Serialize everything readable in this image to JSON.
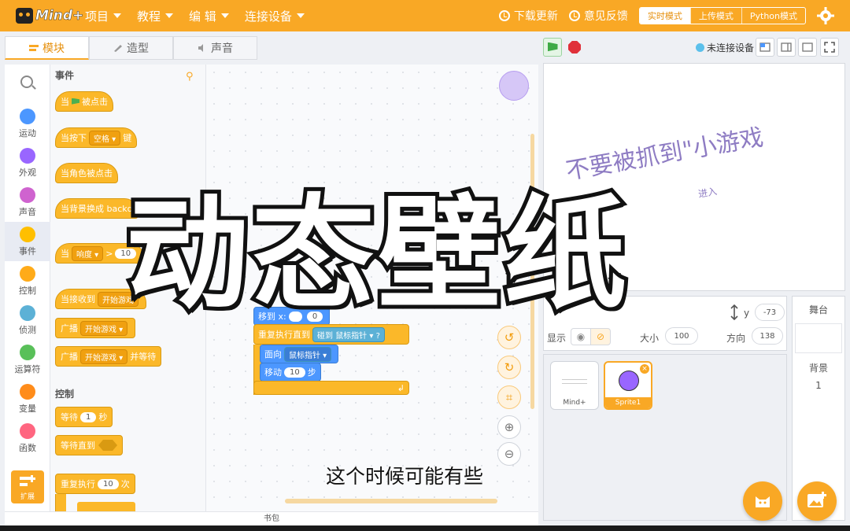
{
  "app": {
    "brand": "Mind+"
  },
  "menu": [
    {
      "label": "项目"
    },
    {
      "label": "教程"
    },
    {
      "label": "编 辑"
    },
    {
      "label": "连接设备"
    }
  ],
  "top_right": {
    "download": "下载更新",
    "feedback": "意见反馈",
    "modes": [
      "实时模式",
      "上传模式",
      "Python模式"
    ]
  },
  "tabs": [
    "模块",
    "造型",
    "声音"
  ],
  "categories": [
    {
      "label": "运动",
      "color": "#4c97ff"
    },
    {
      "label": "外观",
      "color": "#9966ff"
    },
    {
      "label": "声音",
      "color": "#cf63cf"
    },
    {
      "label": "事件",
      "color": "#ffbf00"
    },
    {
      "label": "控制",
      "color": "#ffab19"
    },
    {
      "label": "侦测",
      "color": "#5cb1d6"
    },
    {
      "label": "运算符",
      "color": "#59c059"
    },
    {
      "label": "变量",
      "color": "#ff8c1a"
    },
    {
      "label": "函数",
      "color": "#ff6680"
    }
  ],
  "extension_label": "扩展",
  "palette": {
    "events_title": "事件",
    "control_title": "控制",
    "b1": {
      "pre": "当",
      "post": "被点击"
    },
    "b2": {
      "pre": "当按下",
      "key": "空格",
      "post": "键"
    },
    "b3": {
      "text": "当角色被点击"
    },
    "b4": {
      "text": "当背景换成",
      "val": "backd"
    },
    "b5": {
      "pre": "当",
      "sensor": "响度",
      "op": ">",
      "val": "10"
    },
    "b6": {
      "pre": "当接收到",
      "msg": "开始游戏"
    },
    "b7": {
      "pre": "广播",
      "msg": "开始游戏"
    },
    "b8": {
      "pre": "广播",
      "msg": "开始游戏",
      "post": "并等待"
    },
    "b9": {
      "pre": "等待",
      "val": "1",
      "post": "秒"
    },
    "b10": {
      "text": "等待直到"
    },
    "b11": {
      "pre": "重复执行",
      "val": "10",
      "post": "次"
    }
  },
  "script": {
    "goto": {
      "pre": "移到 x:",
      "y": "0"
    },
    "repeat_until": {
      "pre": "重复执行直到",
      "touch": "碰到",
      "target": "鼠标指针",
      "q": "?"
    },
    "face": {
      "pre": "面向",
      "target": "鼠标指针"
    },
    "move": {
      "pre": "移动",
      "val": "10",
      "post": "步"
    }
  },
  "stage_bar": {
    "connection": "未连接设备"
  },
  "stage": {
    "text": "不要被抓到\"小游戏",
    "sub": "进入"
  },
  "sprite_info": {
    "y_label": "y",
    "y_val": "-73",
    "show_label": "显示",
    "size_label": "大小",
    "size_val": "100",
    "dir_label": "方向",
    "dir_val": "138"
  },
  "sprites": [
    {
      "name": "Mind+"
    },
    {
      "name": "Sprite1"
    }
  ],
  "stage_panel": {
    "title": "舞台",
    "bg_label": "背景",
    "bg_count": "1"
  },
  "backpack": "书包",
  "overlay": {
    "title": "动态壁纸",
    "caption": "这个时候可能有些"
  },
  "colors": {
    "accent": "#f9a825",
    "event_block": "#fbb829",
    "motion_block": "#4c97ff",
    "sprite": "#9966ff"
  }
}
